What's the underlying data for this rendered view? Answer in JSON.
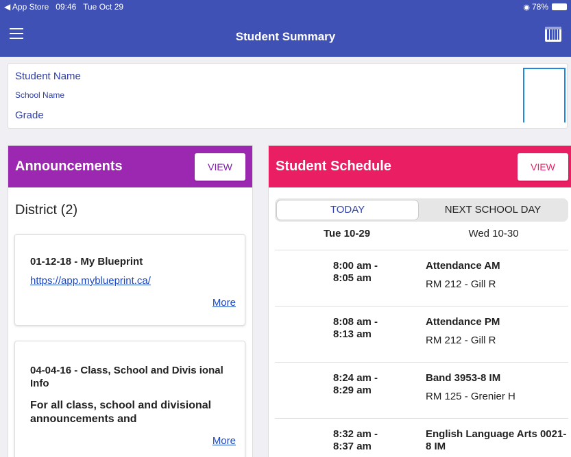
{
  "status_bar": {
    "back_app": "◀ App Store",
    "time": "09:46",
    "date": "Tue Oct 29",
    "battery": "78%"
  },
  "header": {
    "title": "Student Summary"
  },
  "student": {
    "name": "Student Name",
    "school": "School Name",
    "grade": "Grade"
  },
  "announcements": {
    "title": "Announcements",
    "view_label": "VIEW",
    "group": "District (2)",
    "items": [
      {
        "title": "01-12-18 - My Blueprint",
        "link": "https://app.myblueprint.ca/",
        "more": "More"
      },
      {
        "title": "04-04-16 - Class, School and Divis ional Info",
        "body": "For all class, school and divisional announcements and",
        "more": "More"
      }
    ]
  },
  "schedule": {
    "title": "Student Schedule",
    "view_label": "VIEW",
    "tab_today": "TODAY",
    "tab_next": "NEXT SCHOOL DAY",
    "date_today": "Tue 10-29",
    "date_next": "Wed 10-30",
    "rows": [
      {
        "time": "8:00 am -\n8:05 am",
        "class": "Attendance AM",
        "room": "RM 212 - Gill R"
      },
      {
        "time": "8:08 am -\n8:13 am",
        "class": "Attendance PM",
        "room": "RM 212 - Gill R"
      },
      {
        "time": "8:24 am -\n8:29 am",
        "class": "Band 3953-8 IM",
        "room": "RM 125 - Grenier H"
      },
      {
        "time": "8:32 am -\n8:37 am",
        "class": "English Language Arts 0021-8 IM",
        "room": ""
      }
    ]
  },
  "colors": {
    "primary": "#3f51b5",
    "announcements": "#9c27b0",
    "schedule": "#e91e63",
    "link": "#1a47c9"
  }
}
